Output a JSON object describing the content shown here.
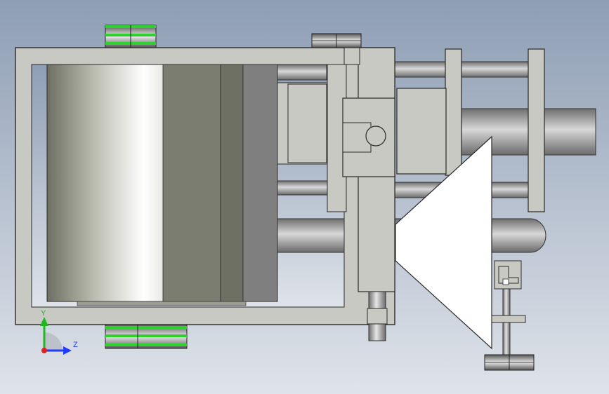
{
  "viewport": {
    "background_top": "#8e9eb4",
    "background_bottom": "#dfe3ea"
  },
  "colors": {
    "frame_fill": "#c9c9c3",
    "frame_stroke": "#2a2a2a",
    "pulley_green": "#2fd12f",
    "rod_fill": "#9a9a9a",
    "cone_fill": "#ffffff"
  },
  "triad": {
    "y_label": "Y",
    "z_label": "Z",
    "y_color": "#1fb81f",
    "z_color": "#1f3cff",
    "origin_color": "#e02020"
  }
}
